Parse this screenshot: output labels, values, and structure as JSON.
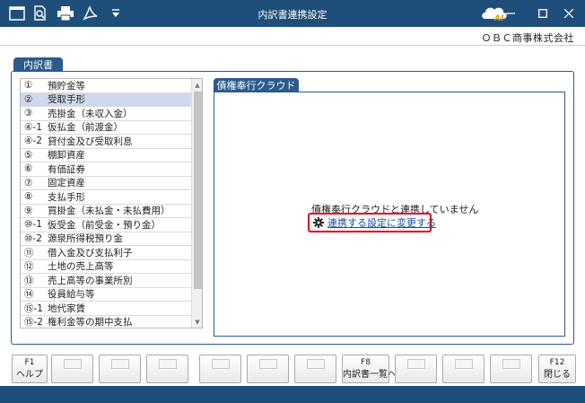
{
  "window": {
    "title": "内訳書連携設定",
    "company": "ＯＢＣ商事株式会社",
    "colors": {
      "titlebar": "#1f4e7a",
      "accent": "#2a5b8c",
      "highlight": "#e3001b",
      "link": "#1a4fa0"
    }
  },
  "toolbar": {
    "icons": [
      "window-icon",
      "search-doc-icon",
      "print-icon",
      "pdf-icon",
      "menu-down-icon"
    ]
  },
  "main": {
    "tab_label": "内訳書",
    "list": [
      {
        "num": "①",
        "label": "預貯金等"
      },
      {
        "num": "②",
        "label": "受取手形"
      },
      {
        "num": "③",
        "label": "売掛金（未収入金）"
      },
      {
        "num": "④-1",
        "label": "仮払金（前渡金）"
      },
      {
        "num": "④-2",
        "label": "貸付金及び受取利息"
      },
      {
        "num": "⑤",
        "label": "棚卸資産"
      },
      {
        "num": "⑥",
        "label": "有価証券"
      },
      {
        "num": "⑦",
        "label": "固定資産"
      },
      {
        "num": "⑧",
        "label": "支払手形"
      },
      {
        "num": "⑨",
        "label": "買掛金（未払金・未払費用）"
      },
      {
        "num": "⑩-1",
        "label": "仮受金（前受金・預り金）"
      },
      {
        "num": "⑩-2",
        "label": "源泉所得税預り金"
      },
      {
        "num": "⑪",
        "label": "借入金及び支払利子"
      },
      {
        "num": "⑫",
        "label": "土地の売上高等"
      },
      {
        "num": "⑬",
        "label": "売上高等の事業所別"
      },
      {
        "num": "⑭",
        "label": "役員給与等"
      },
      {
        "num": "⑮-1",
        "label": "地代家賃"
      },
      {
        "num": "⑮-2",
        "label": "権利金等の期中支払"
      }
    ],
    "selected_index": 1
  },
  "cloud": {
    "tab_label": "債権奉行クラウド",
    "status_text": "債権奉行クラウドと連携していません",
    "link_text": "連携する設定に変更する"
  },
  "fkeys": [
    {
      "name": "F1",
      "label": "ヘルプ"
    },
    {
      "name": "",
      "label": ""
    },
    {
      "name": "",
      "label": ""
    },
    {
      "name": "",
      "label": ""
    },
    {
      "name": "",
      "label": ""
    },
    {
      "name": "",
      "label": ""
    },
    {
      "name": "",
      "label": ""
    },
    {
      "name": "F8",
      "label": "内訳書一覧へ"
    },
    {
      "name": "",
      "label": ""
    },
    {
      "name": "",
      "label": ""
    },
    {
      "name": "",
      "label": ""
    },
    {
      "name": "F12",
      "label": "閉じる"
    }
  ]
}
